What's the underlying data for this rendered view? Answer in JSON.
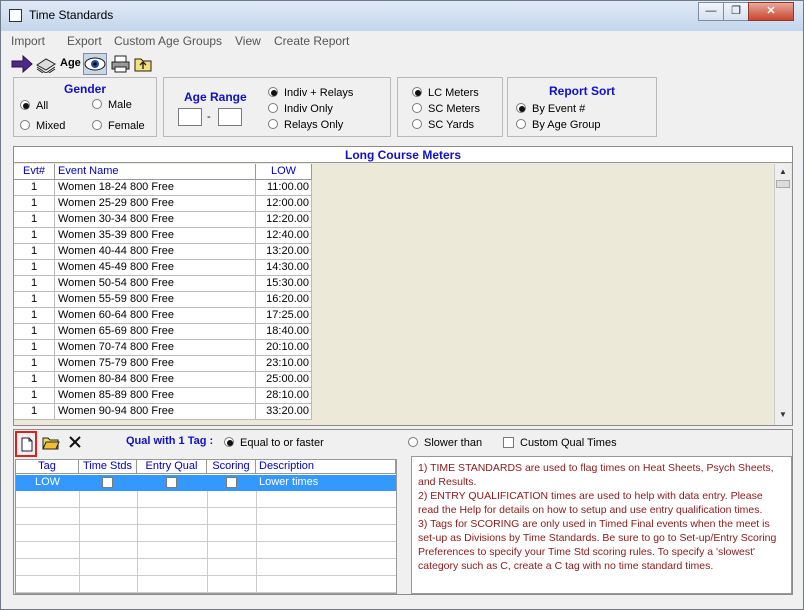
{
  "window": {
    "title": "Time Standards",
    "minimize": "—",
    "restore": "❐",
    "close": "✕"
  },
  "menu": [
    "Import",
    "Export",
    "Custom Age Groups",
    "View",
    "Create Report"
  ],
  "toolbar": {
    "age_label": "Age"
  },
  "gender": {
    "title": "Gender",
    "options": [
      "All",
      "Male",
      "Mixed",
      "Female"
    ],
    "selected": "All"
  },
  "age_range": {
    "title": "Age Range",
    "from": "",
    "separator": "-",
    "to": ""
  },
  "relay": {
    "options": [
      "Indiv + Relays",
      "Indiv Only",
      "Relays Only"
    ],
    "selected": "Indiv + Relays"
  },
  "course": {
    "options": [
      "LC Meters",
      "SC Meters",
      "SC Yards"
    ],
    "selected": "LC Meters"
  },
  "report_sort": {
    "title": "Report Sort",
    "options": [
      "By Event #",
      "By Age Group"
    ],
    "selected": "By Event #"
  },
  "grid": {
    "title": "Long Course Meters",
    "columns": [
      "Evt#",
      "Event Name",
      "LOW"
    ],
    "rows": [
      [
        "1",
        "Women 18-24 800 Free",
        "11:00.00"
      ],
      [
        "1",
        "Women 25-29 800 Free",
        "12:00.00"
      ],
      [
        "1",
        "Women 30-34 800 Free",
        "12:20.00"
      ],
      [
        "1",
        "Women 35-39 800 Free",
        "12:40.00"
      ],
      [
        "1",
        "Women 40-44 800 Free",
        "13:20.00"
      ],
      [
        "1",
        "Women 45-49 800 Free",
        "14:30.00"
      ],
      [
        "1",
        "Women 50-54 800 Free",
        "15:30.00"
      ],
      [
        "1",
        "Women 55-59 800 Free",
        "16:20.00"
      ],
      [
        "1",
        "Women 60-64 800 Free",
        "17:25.00"
      ],
      [
        "1",
        "Women 65-69 800 Free",
        "18:40.00"
      ],
      [
        "1",
        "Women 70-74 800 Free",
        "20:10.00"
      ],
      [
        "1",
        "Women 75-79 800 Free",
        "23:10.00"
      ],
      [
        "1",
        "Women 80-84 800 Free",
        "25:00.00"
      ],
      [
        "1",
        "Women 85-89 800 Free",
        "28:10.00"
      ],
      [
        "1",
        "Women 90-94 800 Free",
        "33:20.00"
      ]
    ]
  },
  "qual": {
    "label": "Qual with 1 Tag :",
    "options": [
      "Equal to or faster",
      "Slower than"
    ],
    "selected": "Equal to or faster",
    "custom_label": "Custom Qual Times"
  },
  "tags_table": {
    "columns": [
      "Tag",
      "Time Stds",
      "Entry Qual",
      "Scoring",
      "Description"
    ],
    "rows": [
      {
        "tag": "LOW",
        "time_stds": true,
        "entry_qual": true,
        "scoring": false,
        "description": "Lower times"
      }
    ]
  },
  "info": [
    "1)  TIME STANDARDS are used to flag times on Heat Sheets, Psych Sheets, and Results.",
    "2)  ENTRY QUALIFICATION times are used to help with data entry. Please read the Help for details on how to setup and use entry qualification times.",
    "3)  Tags for SCORING are only used in Timed Final events when the meet is set-up as Divisions by Time Standards. Be sure to go to Set-up/Entry Scoring Preferences to specify your Time Std scoring rules. To specify a 'slowest' category such as C, create a C tag with no time standard times."
  ],
  "colors": {
    "accent_blue": "#1010c8",
    "info_text": "#8b1a1a",
    "selected_row": "#3399ff",
    "grid_bg": "#ece9d8",
    "new_button_highlight": "#e02020"
  }
}
